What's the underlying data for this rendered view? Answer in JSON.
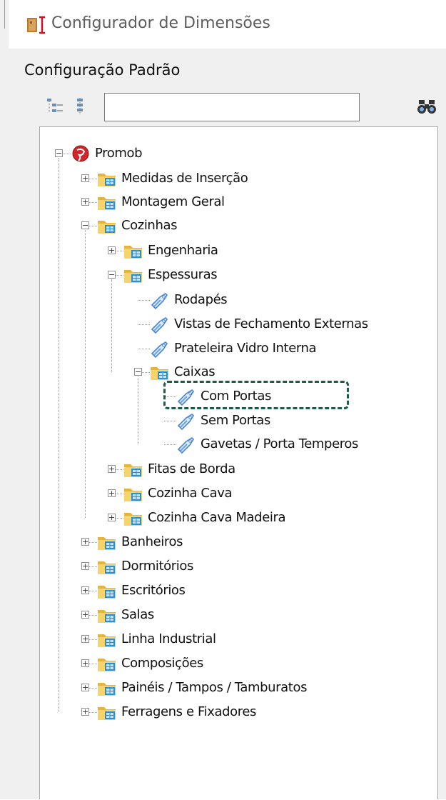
{
  "window": {
    "title": "Configurador de Dimensões"
  },
  "panel": {
    "label": "Configuração Padrão"
  },
  "toolbar": {
    "search_value": "",
    "search_placeholder": ""
  },
  "tree": {
    "root": "Promob",
    "items": [
      "Medidas de Inserção",
      "Montagem Geral",
      "Cozinhas",
      "Engenharia",
      "Espessuras",
      "Rodapés",
      "Vistas de Fechamento Externas",
      "Prateleira Vidro Interna",
      "Caixas",
      "Com Portas",
      "Sem Portas",
      "Gavetas / Porta Temperos",
      "Fitas de Borda",
      "Cozinha Cava",
      "Cozinha Cava Madeira",
      "Banheiros",
      "Dormitórios",
      "Escritórios",
      "Salas",
      "Linha Industrial",
      "Composições",
      "Painéis / Tampos / Tamburatos",
      "Ferragens e Fixadores"
    ]
  },
  "colors": {
    "selection_border": "#1e5b4a",
    "folder": "#f2c24a",
    "tag_icon": "#4a86d8",
    "promob_logo": "#d0262c"
  }
}
